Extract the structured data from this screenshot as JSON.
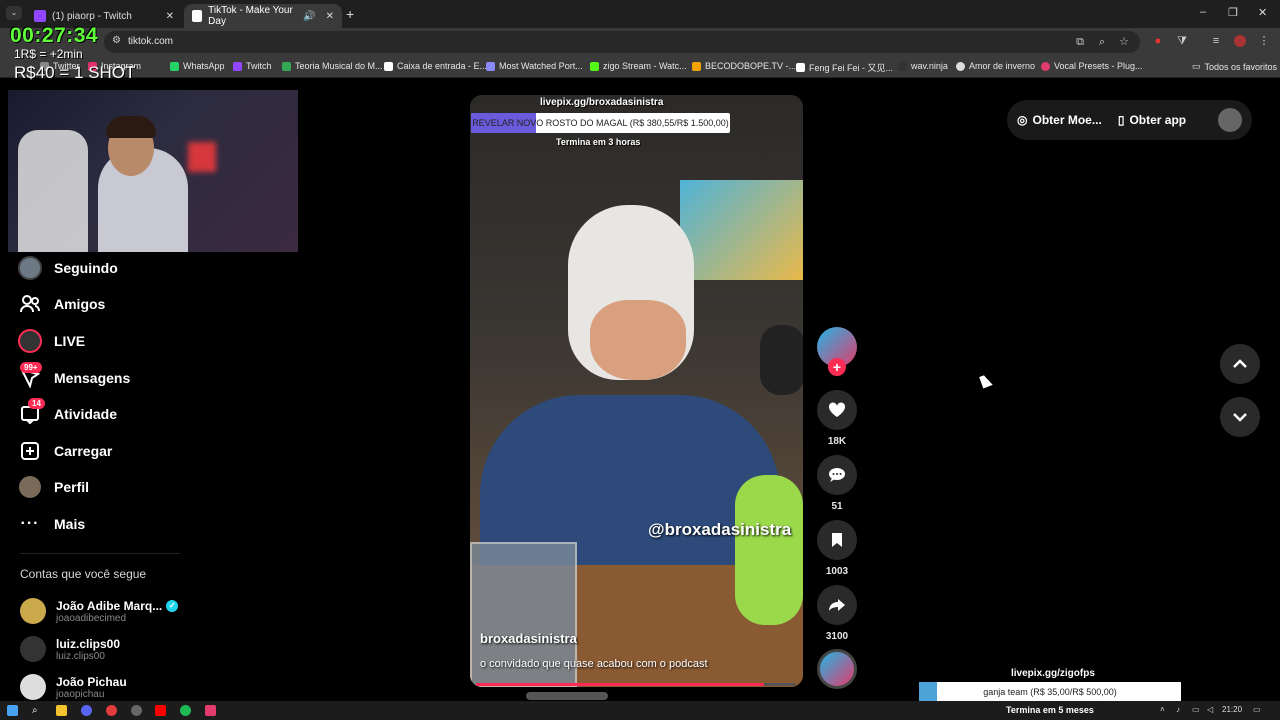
{
  "browser": {
    "tabs": [
      {
        "title": "(1) piaorp - Twitch",
        "favicon_color": "#9146ff"
      },
      {
        "title": "TikTok - Make Your Day",
        "favicon_color": "#ffffff"
      }
    ],
    "url": "tiktok.com",
    "new_tab_label": "+",
    "window_controls": [
      "–",
      "❐",
      "✕"
    ],
    "bookmarks": [
      {
        "label": "Twitter",
        "color": "#888888"
      },
      {
        "label": "Instagram",
        "color": "#e1306c"
      },
      {
        "label": "WhatsApp",
        "color": "#25d366"
      },
      {
        "label": "Twitch",
        "color": "#9146ff"
      },
      {
        "label": "Teoria Musical do M...",
        "color": "#34a853"
      },
      {
        "label": "Caixa de entrada - E...",
        "color": "#ffffff"
      },
      {
        "label": "Most Watched Port...",
        "color": "#8888ff"
      },
      {
        "label": "zigo Stream - Watc...",
        "color": "#53fc18"
      },
      {
        "label": "BECODOBOPE.TV -...",
        "color": "#f4a300"
      },
      {
        "label": "Feng Fei Fei - 又见...",
        "color": "#ffffff"
      },
      {
        "label": "wav.ninja",
        "color": "#333333"
      },
      {
        "label": "Amor de inverno",
        "color": "#dddddd"
      },
      {
        "label": "Vocal Presets - Plug...",
        "color": "#e33c6c"
      }
    ],
    "all_favorites": "Todos os favoritos"
  },
  "overlay": {
    "timer": "00:27:34",
    "rate": "1R$ = +2min",
    "shot": "R$40 = 1 SHOT",
    "top_goal": {
      "url": "livepix.gg/broxadasinistra",
      "label": "REVELAR NOVO ROSTO DO MAGAL (R$ 380,55/R$ 1.500,00)",
      "progress": 0.25,
      "ends": "Termina em 3 horas"
    },
    "bottom_goal": {
      "url": "livepix.gg/zigofps",
      "label": "ganja team (R$ 35,00/R$ 500,00)",
      "progress": 0.07,
      "ends": "Termina em 5 meses"
    }
  },
  "sidebar": {
    "nav": [
      {
        "label": "Seguindo",
        "icon": "following-avatar-icon"
      },
      {
        "label": "Amigos",
        "icon": "friends-icon"
      },
      {
        "label": "LIVE",
        "icon": "live-icon"
      },
      {
        "label": "Mensagens",
        "icon": "messages-icon",
        "badge": "99+"
      },
      {
        "label": "Atividade",
        "icon": "activity-icon",
        "badge": "14"
      },
      {
        "label": "Carregar",
        "icon": "upload-icon"
      },
      {
        "label": "Perfil",
        "icon": "profile-avatar-icon"
      },
      {
        "label": "Mais",
        "icon": "more-icon"
      }
    ],
    "following_title": "Contas que você segue",
    "accounts": [
      {
        "name": "João Adibe Marq...",
        "handle": "joaoadibecimed",
        "verified": true
      },
      {
        "name": "luiz.clips00",
        "handle": "luiz.clips00",
        "verified": false
      },
      {
        "name": "João Pichau",
        "handle": "joaopichau",
        "verified": false
      }
    ]
  },
  "video": {
    "watermark": "@broxadasinistra",
    "author": "broxadasinistra",
    "caption": "o convidado que quase acabou com o podcast",
    "playback_progress": 0.9
  },
  "actions": {
    "likes": "18K",
    "comments": "51",
    "saves": "1003",
    "shares": "3100"
  },
  "topbar": {
    "coins": "Obter Moe...",
    "app": "Obter app"
  },
  "taskbar": {
    "clock": "21:20"
  }
}
